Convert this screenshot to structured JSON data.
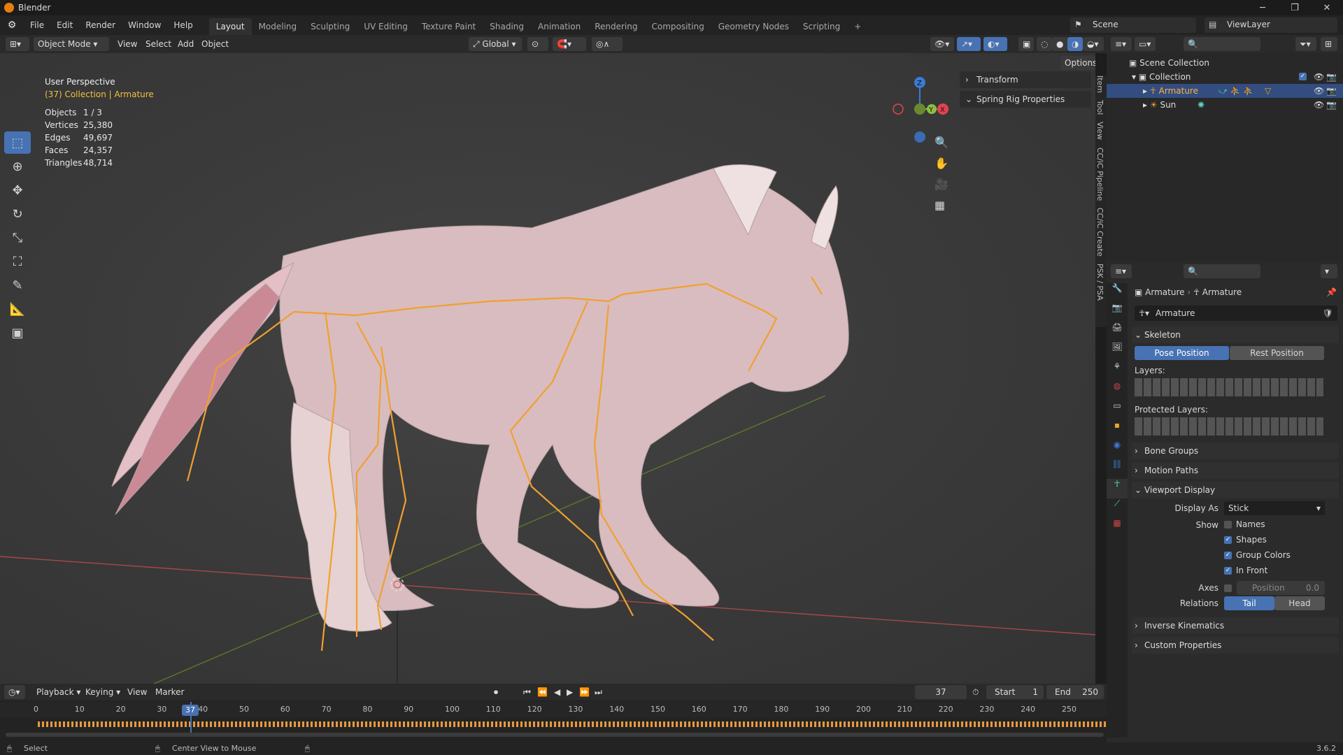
{
  "app": {
    "title": "Blender",
    "version": "3.6.2"
  },
  "menus": [
    "File",
    "Edit",
    "Render",
    "Window",
    "Help"
  ],
  "workspaces": [
    "Layout",
    "Modeling",
    "Sculpting",
    "UV Editing",
    "Texture Paint",
    "Shading",
    "Animation",
    "Rendering",
    "Compositing",
    "Geometry Nodes",
    "Scripting"
  ],
  "active_workspace": "Layout",
  "scene": {
    "name": "Scene",
    "view_layer": "ViewLayer"
  },
  "header3d": {
    "mode": "Object Mode",
    "view": "View",
    "select": "Select",
    "add": "Add",
    "object": "Object",
    "orientation": "Global",
    "options": "Options"
  },
  "viewport": {
    "perspective": "User Perspective",
    "context": "(37) Collection | Armature",
    "stats": [
      {
        "k": "Objects",
        "v": "1 / 3"
      },
      {
        "k": "Vertices",
        "v": "25,380"
      },
      {
        "k": "Edges",
        "v": "49,697"
      },
      {
        "k": "Faces",
        "v": "24,357"
      },
      {
        "k": "Triangles",
        "v": "48,714"
      }
    ]
  },
  "npanel": {
    "transform": "Transform",
    "spring": "Spring Rig Properties",
    "tabs": [
      "Item",
      "Tool",
      "View",
      "CC/iC Pipeline",
      "CC/iC Create",
      "PSK / PSA"
    ]
  },
  "outliner": {
    "root": "Scene Collection",
    "collection": "Collection",
    "armature": "Armature",
    "sun": "Sun"
  },
  "properties": {
    "breadcrumb": [
      "Armature",
      "Armature"
    ],
    "data_name": "Armature",
    "skeleton": "Skeleton",
    "pose_position": "Pose Position",
    "rest_position": "Rest Position",
    "layers": "Layers:",
    "protected_layers": "Protected Layers:",
    "bone_groups": "Bone Groups",
    "motion_paths": "Motion Paths",
    "viewport_display": "Viewport Display",
    "display_as_label": "Display As",
    "display_as": "Stick",
    "show": "Show",
    "names": "Names",
    "shapes": "Shapes",
    "group_colors": "Group Colors",
    "in_front": "In Front",
    "axes": "Axes",
    "axes_position": "Position",
    "axes_value": "0.0",
    "relations": "Relations",
    "tail": "Tail",
    "head": "Head",
    "inverse_kinematics": "Inverse Kinematics",
    "custom_properties": "Custom Properties"
  },
  "timeline": {
    "playback": "Playback",
    "keying": "Keying",
    "view": "View",
    "marker": "Marker",
    "current_frame": "37",
    "start_label": "Start",
    "start": "1",
    "end_label": "End",
    "end": "250",
    "ticks": [
      "0",
      "10",
      "20",
      "30",
      "40",
      "50",
      "60",
      "70",
      "80",
      "90",
      "100",
      "110",
      "120",
      "130",
      "140",
      "150",
      "160",
      "170",
      "180",
      "190",
      "200",
      "210",
      "220",
      "230",
      "240",
      "250"
    ]
  },
  "status": {
    "select": "Select",
    "center": "Center View to Mouse"
  },
  "colors": {
    "accent": "#4772b3",
    "bone": "#f0a030",
    "x_axis": "#e0444f",
    "y_axis": "#8ac041",
    "z_axis": "#3a7bd5"
  }
}
